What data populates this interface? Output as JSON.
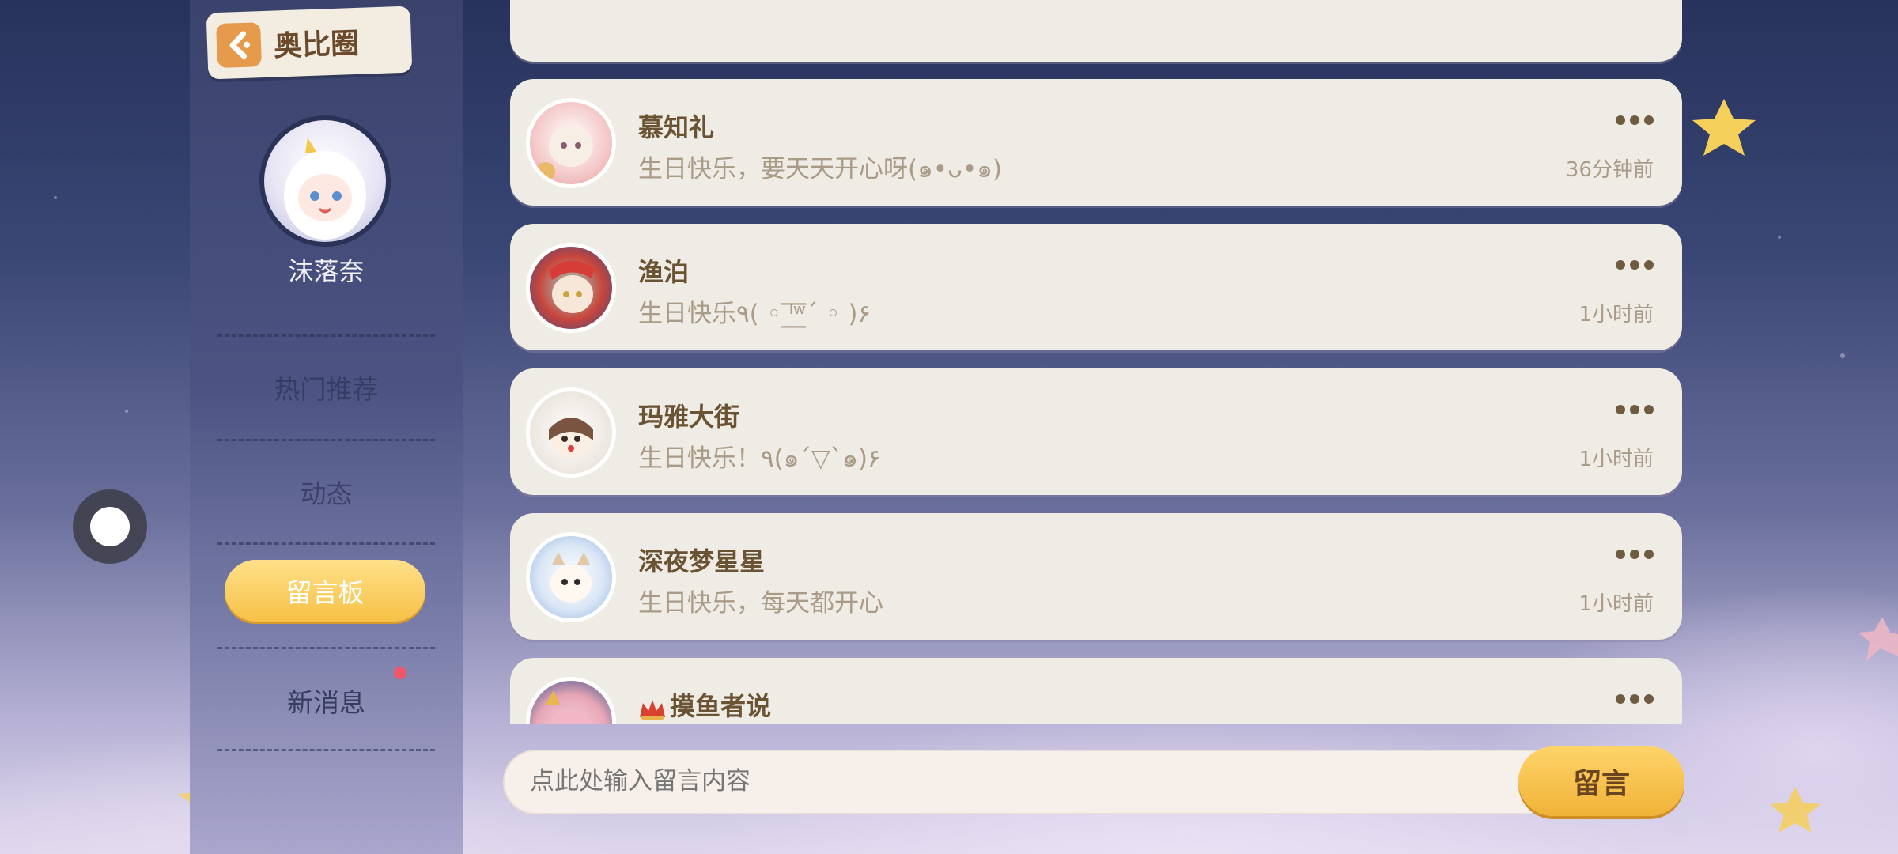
{
  "header": {
    "back_label": "奥比圈"
  },
  "profile": {
    "username": "沫落奈"
  },
  "sidebar": {
    "items": [
      {
        "label": "热门推荐"
      },
      {
        "label": "动态"
      },
      {
        "label": "留言板",
        "active": true
      },
      {
        "label": "新消息",
        "has_notification": true
      }
    ]
  },
  "messages": [
    {
      "name": "慕知礼",
      "text": "生日快乐，要天天开心呀(๑•ᴗ•๑)",
      "time": "36分钟前",
      "avatar_color": "#f4c9c9"
    },
    {
      "name": "渔泊",
      "text": "生日快乐٩( ◦ ˡ̲̅ʷ̲̅ˊ ◦ )۶",
      "time": "1小时前",
      "avatar_color": "#c8453c"
    },
    {
      "name": "玛雅大街",
      "text": "生日快乐！٩(๑ˊ▽ˋ๑)۶",
      "time": "1小时前",
      "avatar_color": "#8b6a52"
    },
    {
      "name": "深夜梦星星",
      "text": "生日快乐，每天都开心",
      "time": "1小时前",
      "avatar_color": "#a9c3e6"
    },
    {
      "name": "摸鱼者说",
      "text": "",
      "time": "",
      "avatar_color": "#e7a6b6"
    }
  ],
  "composer": {
    "placeholder": "点此处输入留言内容",
    "send_label": "留言"
  },
  "colors": {
    "accent": "#f6c146",
    "card_bg": "#efebe5",
    "name_text": "#6a5332",
    "muted_text": "#a99b86"
  }
}
